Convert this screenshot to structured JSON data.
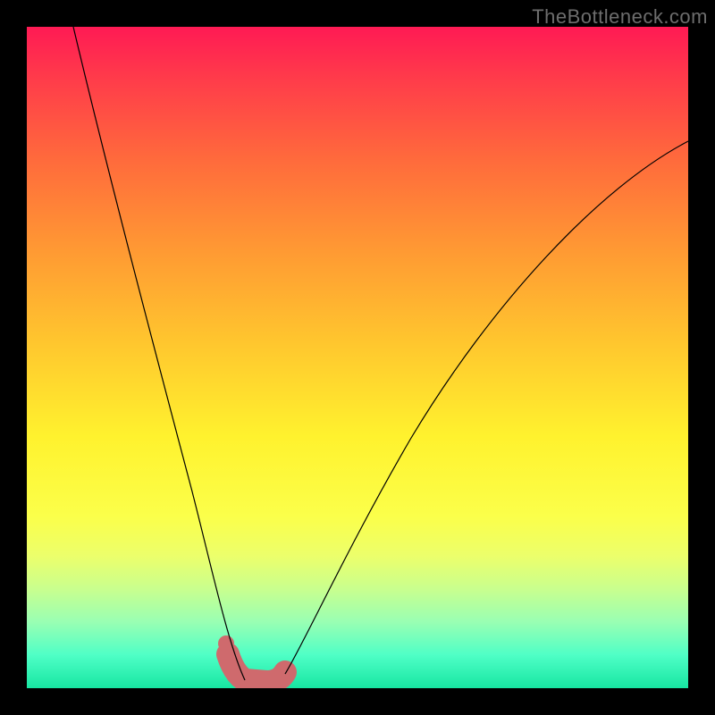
{
  "watermark": "TheBottleneck.com",
  "chart_data": {
    "type": "line",
    "title": "",
    "xlabel": "",
    "ylabel": "",
    "xlim": [
      0,
      100
    ],
    "ylim": [
      0,
      100
    ],
    "grid": false,
    "legend": false,
    "background_gradient": {
      "orientation": "vertical",
      "stops": [
        {
          "pos": 0,
          "color": "#ff1a54"
        },
        {
          "pos": 50,
          "color": "#ffe02e"
        },
        {
          "pos": 80,
          "color": "#f4ff5c"
        },
        {
          "pos": 100,
          "color": "#17e6a2"
        }
      ]
    },
    "series": [
      {
        "name": "left-branch",
        "x": [
          7,
          10,
          14,
          18,
          22,
          25,
          27,
          29,
          30.5,
          31.5,
          32
        ],
        "y": [
          100,
          85,
          68,
          52,
          36,
          24,
          15,
          8,
          4,
          2,
          1
        ]
      },
      {
        "name": "right-branch",
        "x": [
          38,
          40,
          43,
          47,
          53,
          60,
          68,
          78,
          90,
          100
        ],
        "y": [
          1,
          3,
          7,
          14,
          24,
          36,
          49,
          62,
          75,
          83
        ]
      }
    ],
    "highlight": {
      "name": "valley-highlight",
      "color": "#cf6a6d",
      "x": [
        30.5,
        32,
        34,
        36,
        38
      ],
      "y": [
        5.2,
        1.2,
        0.8,
        0.9,
        1.6
      ]
    },
    "highlight_dot": {
      "x": 30.2,
      "y": 6.8,
      "r": 1.3,
      "color": "#cf6a6d"
    }
  }
}
